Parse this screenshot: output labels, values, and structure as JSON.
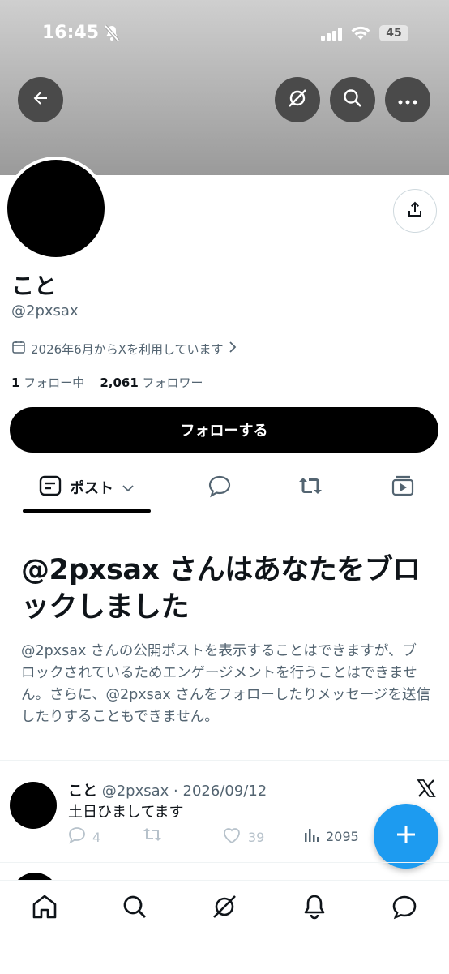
{
  "status_bar": {
    "time": "16:45",
    "battery": "45"
  },
  "profile": {
    "display_name": "こと",
    "handle": "@2pxsax",
    "joined": "2026年6月からXを利用しています",
    "following_count": "1",
    "following_label": "フォロー中",
    "followers_count": "2,061",
    "followers_label": "フォロワー",
    "follow_button": "フォローする"
  },
  "tabs": {
    "posts_label": "ポスト"
  },
  "blocked": {
    "title": "@2pxsax さんはあなたをブロックしました",
    "body": "@2pxsax さんの公開ポストを表示することはできますが、ブロックされているためエンゲージメントを行うことはできません。さらに、@2pxsax さんをフォローしたりメッセージを送信したりすることもできません。"
  },
  "post": {
    "name": "こと",
    "meta": "@2pxsax · 2026/09/12",
    "text": "土日ひましてます",
    "replies": "4",
    "likes": "39",
    "views": "2095"
  },
  "icons": {
    "back": "arrow-left-icon",
    "grok": "grok-icon",
    "search": "search-icon",
    "more": "more-dots-icon",
    "share": "share-icon",
    "compose": "plus-icon"
  },
  "colors": {
    "accent": "#1d9bf0",
    "text": "#0f1419",
    "secondary": "#536471"
  }
}
